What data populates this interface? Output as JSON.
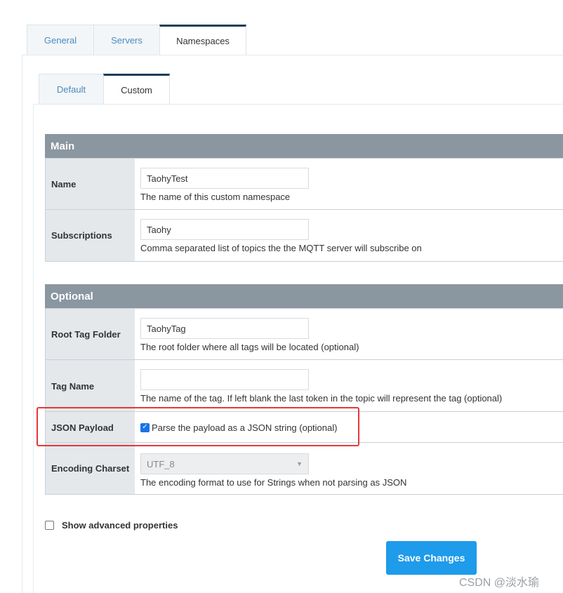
{
  "top_tabs": [
    {
      "label": "General"
    },
    {
      "label": "Servers"
    },
    {
      "label": "Namespaces"
    }
  ],
  "sub_tabs": [
    {
      "label": "Default"
    },
    {
      "label": "Custom"
    }
  ],
  "main": {
    "title": "Main",
    "name": {
      "label": "Name",
      "value": "TaohyTest",
      "help": "The name of this custom namespace"
    },
    "subscriptions": {
      "label": "Subscriptions",
      "value": "Taohy",
      "help": "Comma separated list of topics the the MQTT server will subscribe on"
    }
  },
  "optional": {
    "title": "Optional",
    "root_tag_folder": {
      "label": "Root Tag Folder",
      "value": "TaohyTag",
      "help": "The root folder where all tags will be located (optional)"
    },
    "tag_name": {
      "label": "Tag Name",
      "value": "",
      "help": "The name of the tag. If left blank the last token in the topic will represent the tag (optional)"
    },
    "json_payload": {
      "label": "JSON Payload",
      "checked": true,
      "checkbox_label": "Parse the payload as a JSON string (optional)"
    },
    "encoding_charset": {
      "label": "Encoding Charset",
      "value": "UTF_8",
      "help": "The encoding format to use for Strings when not parsing as JSON"
    }
  },
  "advanced": {
    "label": "Show advanced properties",
    "checked": false
  },
  "save_button": {
    "label": "Save Changes"
  },
  "watermark": "CSDN @淡水瑜",
  "colors": {
    "accent": "#1e9bea",
    "highlight": "#e5383b",
    "section_header": "#8a96a0"
  }
}
